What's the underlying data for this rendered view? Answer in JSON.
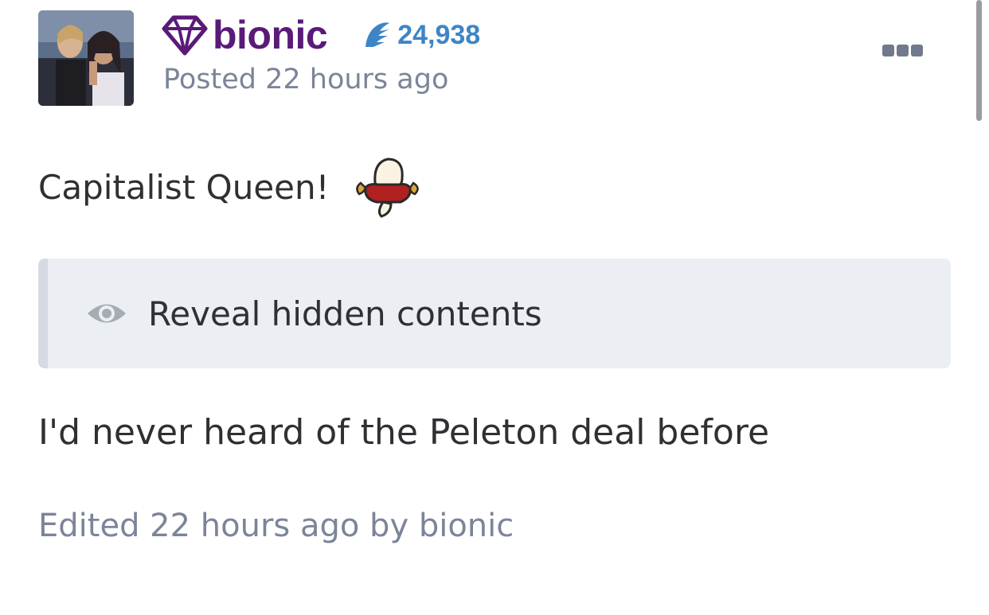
{
  "post": {
    "author": {
      "name": "bionic",
      "badge_icon": "diamond-icon",
      "name_color": "#5a1a78",
      "reputation_icon": "wave-icon",
      "reputation": "24,938",
      "reputation_color": "#3d85c6"
    },
    "posted_time": "Posted 22 hours ago",
    "menu_icon": "more-options-icon",
    "body": {
      "line1": "Capitalist Queen!",
      "emoji_icon": "emoji-icon",
      "spoiler": {
        "icon": "eye-icon",
        "label": "Reveal hidden contents"
      },
      "line2": "I'd never heard of the Peleton deal before"
    },
    "edited_note": "Edited 22 hours ago by bionic"
  }
}
